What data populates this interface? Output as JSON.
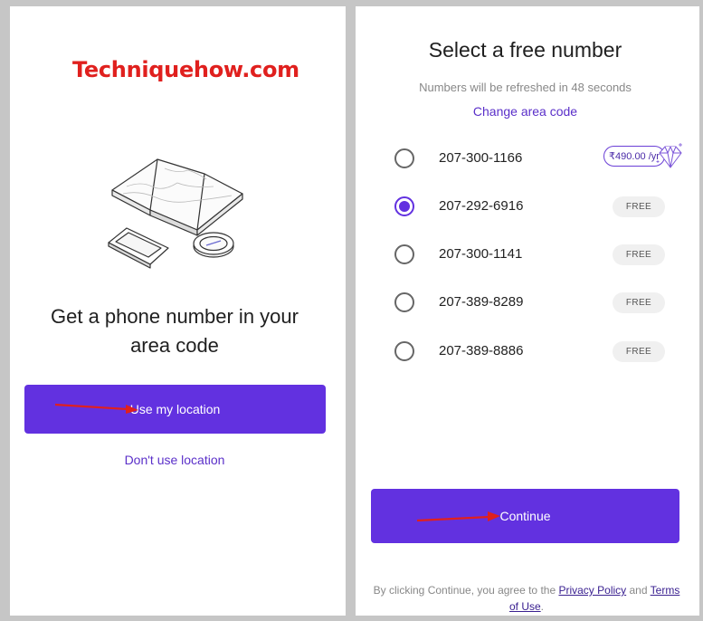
{
  "watermark": "Techniquehow.com",
  "left": {
    "headline_line1": "Get a phone number in your",
    "headline_line2": "area code",
    "use_location_label": "Use my location",
    "dont_use_label": "Don't use location"
  },
  "right": {
    "title": "Select a free number",
    "subtitle": "Numbers will be refreshed in 48 seconds",
    "change_area_label": "Change area code",
    "numbers": [
      {
        "number": "207-300-1166",
        "badge": "₹490.00 /yr",
        "selected": false,
        "premium": true
      },
      {
        "number": "207-292-6916",
        "badge": "FREE",
        "selected": true,
        "premium": false
      },
      {
        "number": "207-300-1141",
        "badge": "FREE",
        "selected": false,
        "premium": false
      },
      {
        "number": "207-389-8289",
        "badge": "FREE",
        "selected": false,
        "premium": false
      },
      {
        "number": "207-389-8886",
        "badge": "FREE",
        "selected": false,
        "premium": false
      }
    ],
    "continue_label": "Continue",
    "legal_prefix": "By clicking Continue, you agree to the",
    "privacy_label": "Privacy Policy",
    "legal_and": "and",
    "terms_label": "Terms of Use",
    "legal_suffix": "."
  },
  "colors": {
    "accent": "#6231e0",
    "watermark": "#e0201e",
    "annotation_arrow": "#e0201e"
  },
  "icons": [
    "map-illustration-icon",
    "radio-button-icon",
    "diamond-icon",
    "red-arrow-annotation-icon"
  ]
}
